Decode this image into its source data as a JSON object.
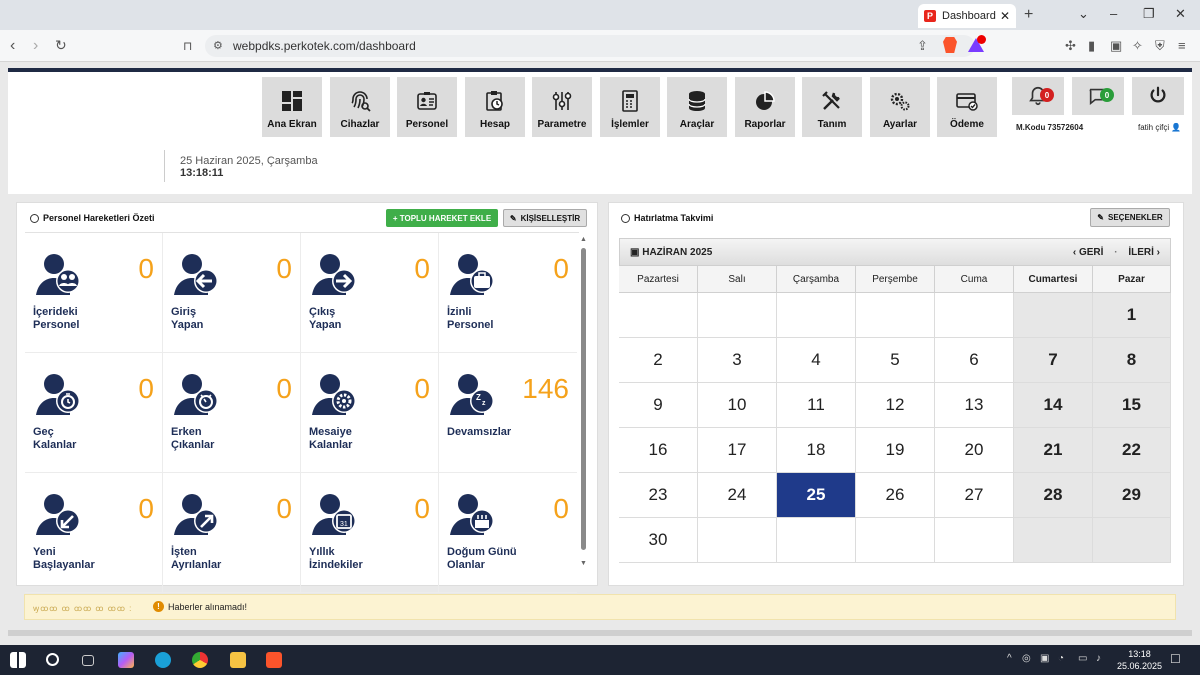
{
  "browser": {
    "tab_title": "Dashboard",
    "tab_close": "✕",
    "new_tab": "+",
    "url": "webpdks.perkotek.com/dashboard"
  },
  "menu": [
    {
      "label": "Ana Ekran",
      "icon": "dashboard-icon"
    },
    {
      "label": "Cihazlar",
      "icon": "fingerprint-icon"
    },
    {
      "label": "Personel",
      "icon": "id-card-icon"
    },
    {
      "label": "Hesap",
      "icon": "clipboard-clock-icon"
    },
    {
      "label": "Parametre",
      "icon": "sliders-icon"
    },
    {
      "label": "İşlemler",
      "icon": "calculator-icon"
    },
    {
      "label": "Araçlar",
      "icon": "database-icon"
    },
    {
      "label": "Raporlar",
      "icon": "pie-chart-icon"
    },
    {
      "label": "Tanım",
      "icon": "tools-icon"
    },
    {
      "label": "Ayarlar",
      "icon": "gears-icon"
    },
    {
      "label": "Ödeme",
      "icon": "payment-icon"
    }
  ],
  "notifications": {
    "bell_count": "0",
    "chat_count": "0"
  },
  "account": {
    "code": "M.Kodu 73572604",
    "user": "fatih çifçi"
  },
  "datetime": {
    "date": "25 Haziran 2025, Çarşamba",
    "time": "13:18:11"
  },
  "left_panel": {
    "title": "Personel Hareketleri Özeti",
    "bulk_button": "+ TOPLU HAREKET EKLE",
    "customize_button": "KİŞİSELLEŞTİR",
    "stats": [
      {
        "label": "İçerideki\nPersonel",
        "value": "0",
        "icon": "people-icon"
      },
      {
        "label": "Giriş\nYapan",
        "value": "0",
        "icon": "arrow-left-icon"
      },
      {
        "label": "Çıkış\nYapan",
        "value": "0",
        "icon": "arrow-right-icon"
      },
      {
        "label": "İzinli\nPersonel",
        "value": "0",
        "icon": "suitcase-icon"
      },
      {
        "label": "Geç\nKalanlar",
        "value": "0",
        "icon": "stopwatch-icon"
      },
      {
        "label": "Erken\nÇıkanlar",
        "value": "0",
        "icon": "timer-icon"
      },
      {
        "label": "Mesaiye\nKalanlar",
        "value": "0",
        "icon": "gear-icon"
      },
      {
        "label": "Devamsızlar",
        "value": "146",
        "icon": "sleep-icon"
      },
      {
        "label": "Yeni\nBaşlayanlar",
        "value": "0",
        "icon": "arrow-down-left-icon"
      },
      {
        "label": "İşten\nAyrılanlar",
        "value": "0",
        "icon": "arrow-up-right-icon"
      },
      {
        "label": "Yıllık\nİzindekiler",
        "value": "0",
        "icon": "calendar-icon"
      },
      {
        "label": "Doğum Günü\nOlanlar",
        "value": "0",
        "icon": "cake-icon"
      }
    ]
  },
  "right_panel": {
    "title": "Hatırlatma Takvimi",
    "options_button": "SEÇENEKLER",
    "month": "HAZİRAN 2025",
    "prev": "GERİ",
    "next": "İLERİ",
    "day_names": [
      "Pazartesi",
      "Salı",
      "Çarşamba",
      "Perşembe",
      "Cuma",
      "Cumartesi",
      "Pazar"
    ],
    "weeks": [
      [
        "",
        "",
        "",
        "",
        "",
        "",
        "1"
      ],
      [
        "2",
        "3",
        "4",
        "5",
        "6",
        "7",
        "8"
      ],
      [
        "9",
        "10",
        "11",
        "12",
        "13",
        "14",
        "15"
      ],
      [
        "16",
        "17",
        "18",
        "19",
        "20",
        "21",
        "22"
      ],
      [
        "23",
        "24",
        "25",
        "26",
        "27",
        "28",
        "29"
      ],
      [
        "30",
        "",
        "",
        "",
        "",
        "",
        ""
      ]
    ],
    "today": "25"
  },
  "news": {
    "blurred": "ꝡꝏꝏ ꝏ ꝏꝏ ꝏ ꝏꝏ :",
    "message": "Haberler alınamadı!"
  },
  "taskbar": {
    "time": "13:18",
    "date": "25.06.2025"
  },
  "colors": {
    "accent_orange": "#f5a21b",
    "navy": "#1e2e57",
    "today": "#1f3a8a",
    "green": "#3fae49"
  }
}
